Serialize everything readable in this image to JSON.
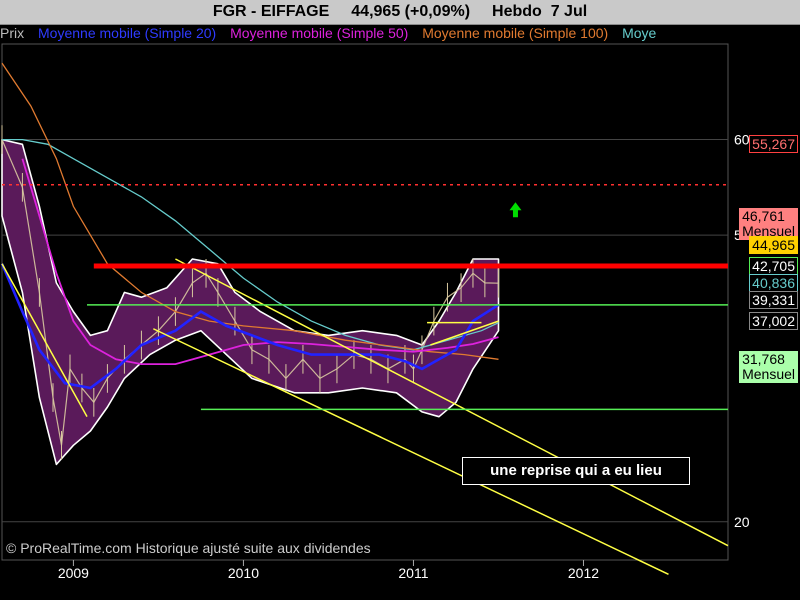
{
  "header": {
    "symbol": "FGR - EIFFAGE",
    "price_change": "44,965 (+0,09%)",
    "period": "Hebdo",
    "date": "7 Jul"
  },
  "legend": {
    "prix": "Prix",
    "ma20": "Moyenne mobile (Simple 20)",
    "ma50": "Moyenne mobile (Simple 50)",
    "ma100": "Moyenne mobile (Simple 100)",
    "ma_extra": "Moye"
  },
  "tags": {
    "t1": "55,267",
    "t2": "46,761",
    "t2b": "Mensuel",
    "t3": "44,965",
    "t4": "42,705",
    "t5": "40,836",
    "t6": "39,331",
    "t7": "37,002",
    "t8": "31,768",
    "t8b": "Mensuel"
  },
  "annotation": "une reprise qui a eu lieu",
  "copyright": "© ProRealTime.com Historique ajusté suite aux dividendes",
  "colors": {
    "ma20": "#2222ff",
    "ma50": "#dd22dd",
    "ma100": "#e07a30",
    "ma200": "#66cccc",
    "band": "#5a1a5a",
    "resistance": "#ff0000",
    "channel": "#ffff44",
    "support": "#55ee55",
    "arrow": "#00dd00"
  },
  "chart_data": {
    "type": "line",
    "ylim": [
      16,
      70
    ],
    "y_ticks": [
      20,
      50,
      60
    ],
    "y_tick_labels": [
      "20",
      "50",
      "60"
    ],
    "x_ticks": [
      "2009",
      "2010",
      "2011",
      "2012"
    ],
    "x_tick_values": [
      2009.0,
      2010.0,
      2011.0,
      2012.0
    ],
    "xlim": [
      2008.58,
      2012.85
    ],
    "price_closes": [
      [
        2008.58,
        60.0
      ],
      [
        2008.7,
        55.0
      ],
      [
        2008.8,
        44.0
      ],
      [
        2008.88,
        33.0
      ],
      [
        2008.93,
        28.0
      ],
      [
        2008.98,
        36.0
      ],
      [
        2009.05,
        34.0
      ],
      [
        2009.12,
        32.5
      ],
      [
        2009.2,
        35.0
      ],
      [
        2009.3,
        37.0
      ],
      [
        2009.4,
        38.5
      ],
      [
        2009.5,
        40.0
      ],
      [
        2009.6,
        42.0
      ],
      [
        2009.7,
        45.0
      ],
      [
        2009.78,
        46.0
      ],
      [
        2009.85,
        44.0
      ],
      [
        2009.95,
        41.0
      ],
      [
        2010.05,
        38.0
      ],
      [
        2010.15,
        37.0
      ],
      [
        2010.25,
        35.0
      ],
      [
        2010.35,
        37.0
      ],
      [
        2010.45,
        35.0
      ],
      [
        2010.55,
        36.0
      ],
      [
        2010.65,
        37.5
      ],
      [
        2010.75,
        37.0
      ],
      [
        2010.85,
        36.0
      ],
      [
        2010.95,
        37.0
      ],
      [
        2011.0,
        36.0
      ],
      [
        2011.05,
        38.0
      ],
      [
        2011.12,
        41.0
      ],
      [
        2011.2,
        43.5
      ],
      [
        2011.28,
        44.5
      ],
      [
        2011.35,
        46.0
      ],
      [
        2011.42,
        45.0
      ],
      [
        2011.5,
        44.965
      ]
    ],
    "bollinger_upper": [
      [
        2008.58,
        60.0
      ],
      [
        2008.7,
        59.5
      ],
      [
        2008.8,
        53.0
      ],
      [
        2008.9,
        45.0
      ],
      [
        2009.0,
        42.0
      ],
      [
        2009.1,
        39.5
      ],
      [
        2009.2,
        40.0
      ],
      [
        2009.3,
        44.0
      ],
      [
        2009.4,
        43.5
      ],
      [
        2009.55,
        44.5
      ],
      [
        2009.7,
        47.5
      ],
      [
        2009.85,
        47.0
      ],
      [
        2009.95,
        44.0
      ],
      [
        2010.1,
        42.0
      ],
      [
        2010.3,
        40.0
      ],
      [
        2010.5,
        39.5
      ],
      [
        2010.7,
        40.0
      ],
      [
        2010.9,
        39.5
      ],
      [
        2011.05,
        38.5
      ],
      [
        2011.15,
        41.0
      ],
      [
        2011.25,
        44.0
      ],
      [
        2011.35,
        47.5
      ],
      [
        2011.5,
        47.5
      ]
    ],
    "bollinger_lower": [
      [
        2008.58,
        52.0
      ],
      [
        2008.7,
        44.0
      ],
      [
        2008.8,
        33.0
      ],
      [
        2008.9,
        26.0
      ],
      [
        2009.0,
        28.0
      ],
      [
        2009.1,
        29.5
      ],
      [
        2009.2,
        32.0
      ],
      [
        2009.3,
        35.0
      ],
      [
        2009.45,
        37.5
      ],
      [
        2009.6,
        39.0
      ],
      [
        2009.75,
        40.0
      ],
      [
        2009.9,
        37.5
      ],
      [
        2010.05,
        35.0
      ],
      [
        2010.3,
        33.5
      ],
      [
        2010.5,
        33.5
      ],
      [
        2010.7,
        34.0
      ],
      [
        2010.9,
        33.5
      ],
      [
        2011.05,
        31.5
      ],
      [
        2011.15,
        31.0
      ],
      [
        2011.25,
        32.5
      ],
      [
        2011.35,
        36.0
      ],
      [
        2011.5,
        40.0
      ]
    ],
    "ma20": [
      [
        2008.58,
        47.0
      ],
      [
        2008.7,
        42.0
      ],
      [
        2008.8,
        38.0
      ],
      [
        2008.95,
        34.5
      ],
      [
        2009.1,
        34.0
      ],
      [
        2009.25,
        36.0
      ],
      [
        2009.4,
        38.5
      ],
      [
        2009.6,
        40.0
      ],
      [
        2009.75,
        42.0
      ],
      [
        2009.9,
        40.5
      ],
      [
        2010.05,
        39.5
      ],
      [
        2010.2,
        38.5
      ],
      [
        2010.4,
        37.5
      ],
      [
        2010.6,
        37.5
      ],
      [
        2010.8,
        37.5
      ],
      [
        2010.95,
        36.8
      ],
      [
        2011.05,
        36.0
      ],
      [
        2011.15,
        37.0
      ],
      [
        2011.25,
        38.0
      ],
      [
        2011.35,
        41.0
      ],
      [
        2011.5,
        42.705
      ]
    ],
    "ma50": [
      [
        2008.7,
        58.0
      ],
      [
        2008.8,
        52.0
      ],
      [
        2008.9,
        46.0
      ],
      [
        2009.0,
        41.0
      ],
      [
        2009.1,
        38.5
      ],
      [
        2009.25,
        37.0
      ],
      [
        2009.4,
        36.5
      ],
      [
        2009.6,
        36.5
      ],
      [
        2009.8,
        37.5
      ],
      [
        2010.0,
        38.5
      ],
      [
        2010.2,
        38.8
      ],
      [
        2010.4,
        38.6
      ],
      [
        2010.6,
        38.3
      ],
      [
        2010.8,
        38.0
      ],
      [
        2011.0,
        37.8
      ],
      [
        2011.2,
        38.2
      ],
      [
        2011.35,
        38.6
      ],
      [
        2011.5,
        39.331
      ]
    ],
    "ma100": [
      [
        2008.58,
        68.0
      ],
      [
        2008.75,
        63.5
      ],
      [
        2008.9,
        58.0
      ],
      [
        2009.0,
        53.0
      ],
      [
        2009.2,
        47.0
      ],
      [
        2009.4,
        44.0
      ],
      [
        2009.6,
        42.0
      ],
      [
        2009.8,
        41.0
      ],
      [
        2010.0,
        40.5
      ],
      [
        2010.3,
        40.0
      ],
      [
        2010.6,
        39.0
      ],
      [
        2010.9,
        38.3
      ],
      [
        2011.1,
        37.8
      ],
      [
        2011.3,
        37.5
      ],
      [
        2011.5,
        37.002
      ]
    ],
    "ma200": [
      [
        2008.58,
        60.0
      ],
      [
        2008.7,
        60.0
      ],
      [
        2008.85,
        59.5
      ],
      [
        2009.0,
        58.0
      ],
      [
        2009.2,
        56.0
      ],
      [
        2009.4,
        54.0
      ],
      [
        2009.6,
        51.5
      ],
      [
        2009.8,
        48.5
      ],
      [
        2010.0,
        45.5
      ],
      [
        2010.2,
        43.0
      ],
      [
        2010.4,
        41.0
      ],
      [
        2010.6,
        39.5
      ],
      [
        2010.8,
        38.5
      ],
      [
        2011.0,
        38.0
      ],
      [
        2011.2,
        39.0
      ],
      [
        2011.4,
        40.0
      ],
      [
        2011.5,
        40.836
      ]
    ],
    "hlines": [
      {
        "y": 55.267,
        "style": "dashed",
        "color": "#ff3030",
        "from": 2008.58,
        "to": 2012.85
      },
      {
        "y": 46.761,
        "style": "thick",
        "color": "#ff0000",
        "from": 2009.12,
        "to": 2012.85
      },
      {
        "y": 42.705,
        "style": "thin",
        "color": "#55ee55",
        "from": 2009.08,
        "to": 2012.85
      },
      {
        "y": 31.768,
        "style": "thin",
        "color": "#55ee55",
        "from": 2009.75,
        "to": 2012.85
      },
      {
        "y": 40.836,
        "style": "short",
        "color": "#ffff44",
        "from": 2011.08,
        "to": 2011.4
      }
    ],
    "trendlines": [
      [
        [
          2008.58,
          47.0
        ],
        [
          2009.08,
          31.0
        ]
      ],
      [
        [
          2009.6,
          47.5
        ],
        [
          2012.85,
          17.5
        ]
      ],
      [
        [
          2009.47,
          40.2
        ],
        [
          2012.5,
          14.5
        ]
      ],
      [
        [
          2011.1,
          38.5
        ],
        [
          2011.5,
          41.0
        ]
      ]
    ],
    "arrow_up": [
      2011.6,
      52.6
    ]
  }
}
